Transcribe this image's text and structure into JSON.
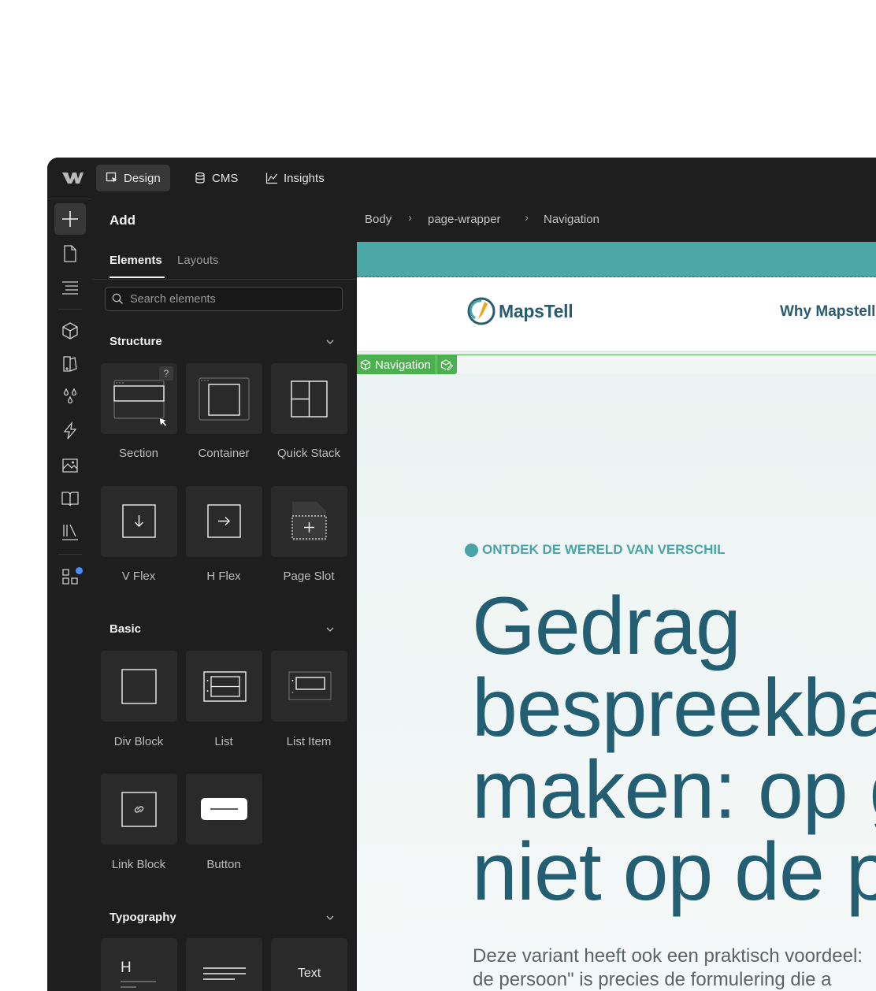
{
  "topbar": {
    "modes": [
      {
        "label": "Design",
        "icon": "cursor-select-icon",
        "active": true
      },
      {
        "label": "CMS",
        "icon": "database-icon",
        "active": false
      },
      {
        "label": "Insights",
        "icon": "line-chart-icon",
        "active": false
      }
    ]
  },
  "add_panel": {
    "title": "Add",
    "tabs": [
      {
        "label": "Elements",
        "active": true
      },
      {
        "label": "Layouts",
        "active": false
      }
    ],
    "search_placeholder": "Search elements",
    "sections": [
      {
        "title": "Structure",
        "items": [
          "Section",
          "Container",
          "Quick Stack",
          "V Flex",
          "H Flex",
          "Page Slot"
        ]
      },
      {
        "title": "Basic",
        "items": [
          "Div Block",
          "List",
          "List Item",
          "Link Block",
          "Button"
        ]
      },
      {
        "title": "Typography",
        "items": [
          "H",
          "Text"
        ]
      }
    ],
    "help_badge": "?"
  },
  "breadcrumb": [
    "Body",
    "page-wrapper",
    "Navigation"
  ],
  "canvas": {
    "brand": "MapsTell",
    "nav_link": "Why Mapstell",
    "selection_tag": "Navigation",
    "eyebrow": "ONTDEK DE WERELD VAN VERSCHIL",
    "headline": "Gedrag\nbespreekbaar\nmaken: op gedrag,\nniet op de persoon",
    "lead": "Deze variant heeft ook een praktisch voordeel:\nde persoon\" is precies de formulering die a",
    "colors": {
      "brand": "#2a5c70",
      "accent": "#4aa3a6",
      "teal_bar": "#4ca7a7",
      "selection": "#4caf50"
    }
  }
}
